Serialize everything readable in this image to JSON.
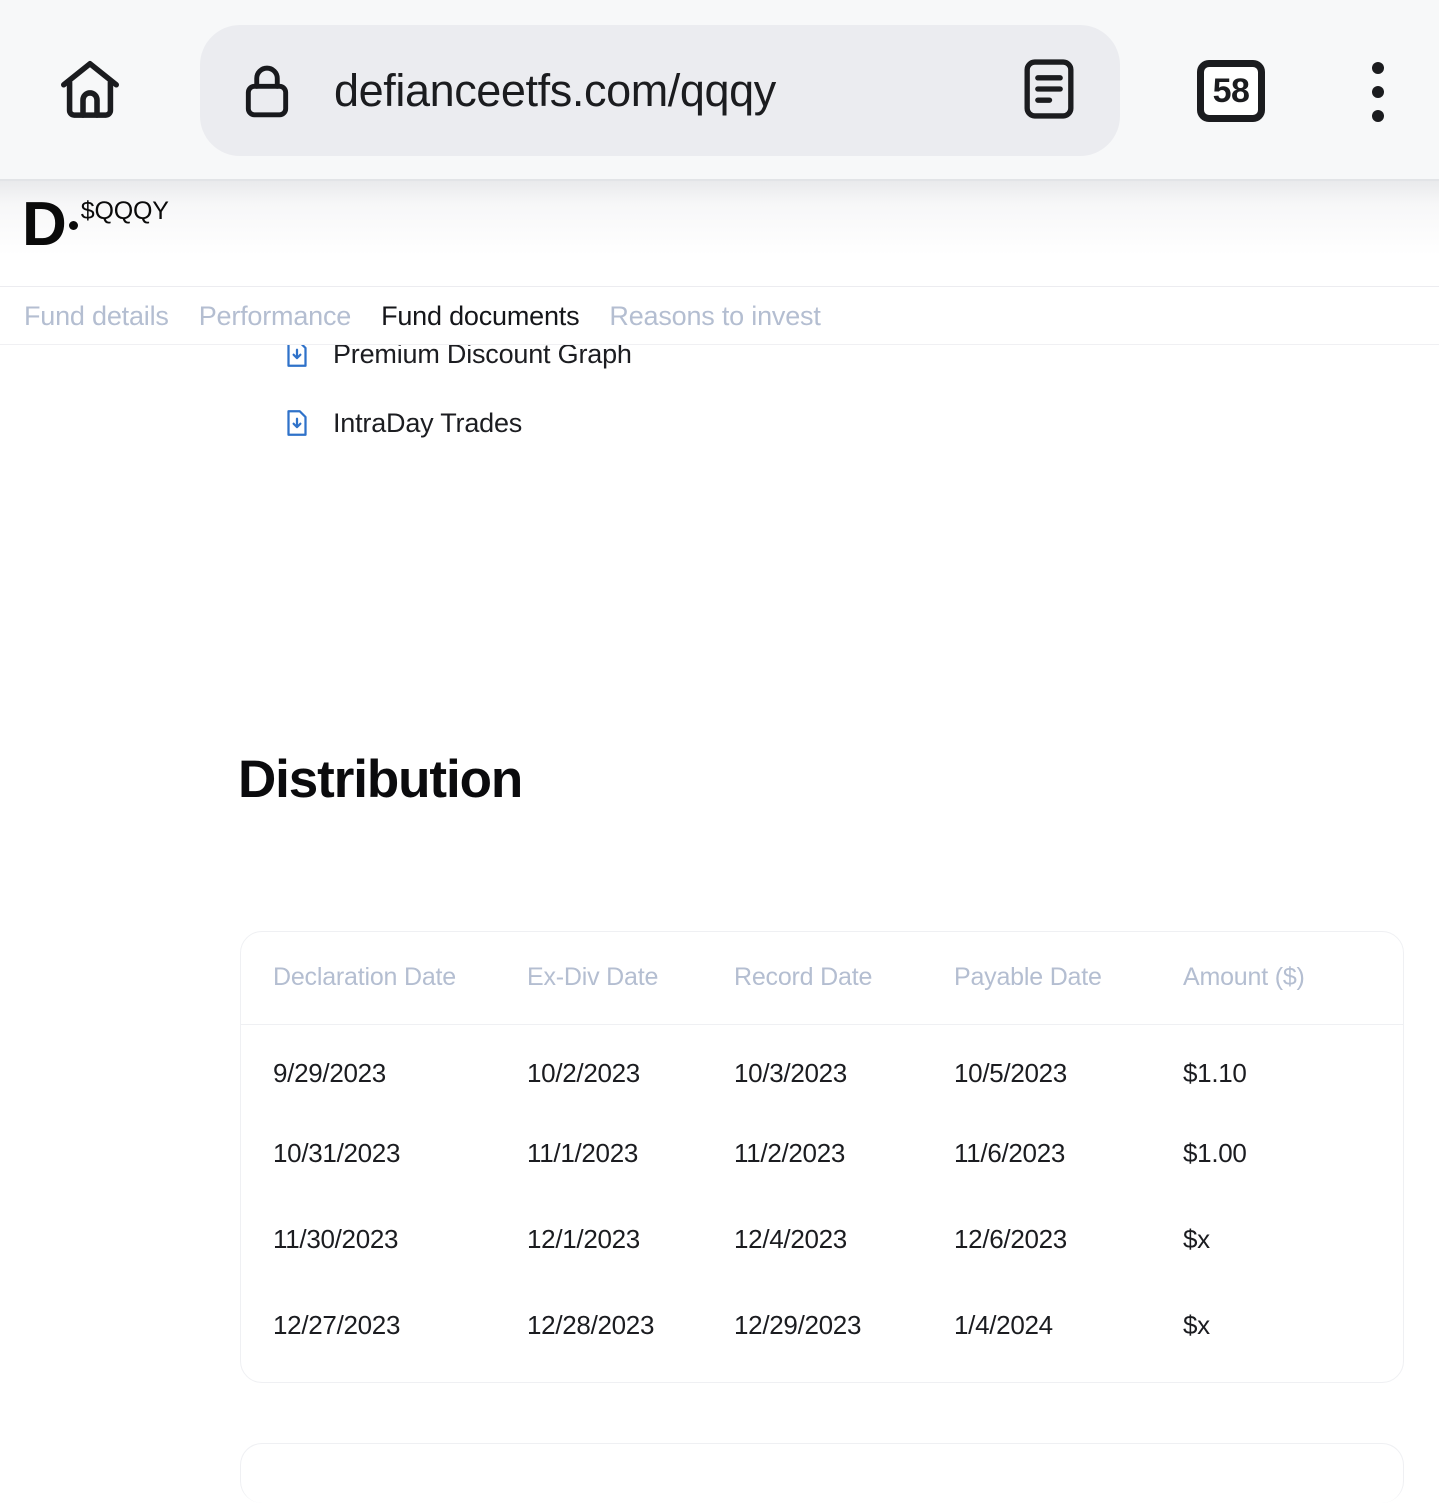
{
  "browser": {
    "home_icon": "home-icon",
    "lock_icon": "lock-icon",
    "url": "defianceetfs.com/qqqy",
    "url_placeholder": "Search or type URL",
    "reader_icon": "reader-mode-icon",
    "tab_count": "58",
    "menu_icon": "overflow-menu-icon"
  },
  "site": {
    "brand_letter": "D",
    "brand_ticker": "$QQQY"
  },
  "section_nav": {
    "tabs": [
      {
        "label": "Fund details",
        "active": false
      },
      {
        "label": "Performance",
        "active": false
      },
      {
        "label": "Fund documents",
        "active": true
      },
      {
        "label": "Reasons to invest",
        "active": false
      }
    ]
  },
  "documents": {
    "items": [
      {
        "label": "Premium Discount Graph",
        "icon": "document-download-icon"
      },
      {
        "label": "IntraDay Trades",
        "icon": "document-download-icon"
      }
    ]
  },
  "distribution": {
    "title": "Distribution",
    "columns": [
      "Declaration Date",
      "Ex-Div Date",
      "Record Date",
      "Payable Date",
      "Amount ($)"
    ],
    "rows": [
      [
        "9/29/2023",
        "10/2/2023",
        "10/3/2023",
        "10/5/2023",
        "$1.10"
      ],
      [
        "10/31/2023",
        "11/1/2023",
        "11/2/2023",
        "11/6/2023",
        "$1.00"
      ],
      [
        "11/30/2023",
        "12/1/2023",
        "12/4/2023",
        "12/6/2023",
        "$x"
      ],
      [
        "12/27/2023",
        "12/28/2023",
        "12/29/2023",
        "1/4/2024",
        "$x"
      ]
    ]
  },
  "colors": {
    "chrome_bg": "#f7f8f9",
    "url_pill_bg": "#ebecf0",
    "muted_text": "#b4bed1",
    "body_text": "#1b1c20",
    "doc_icon_blue": "#2f72c9",
    "card_border": "#eff0f3"
  }
}
